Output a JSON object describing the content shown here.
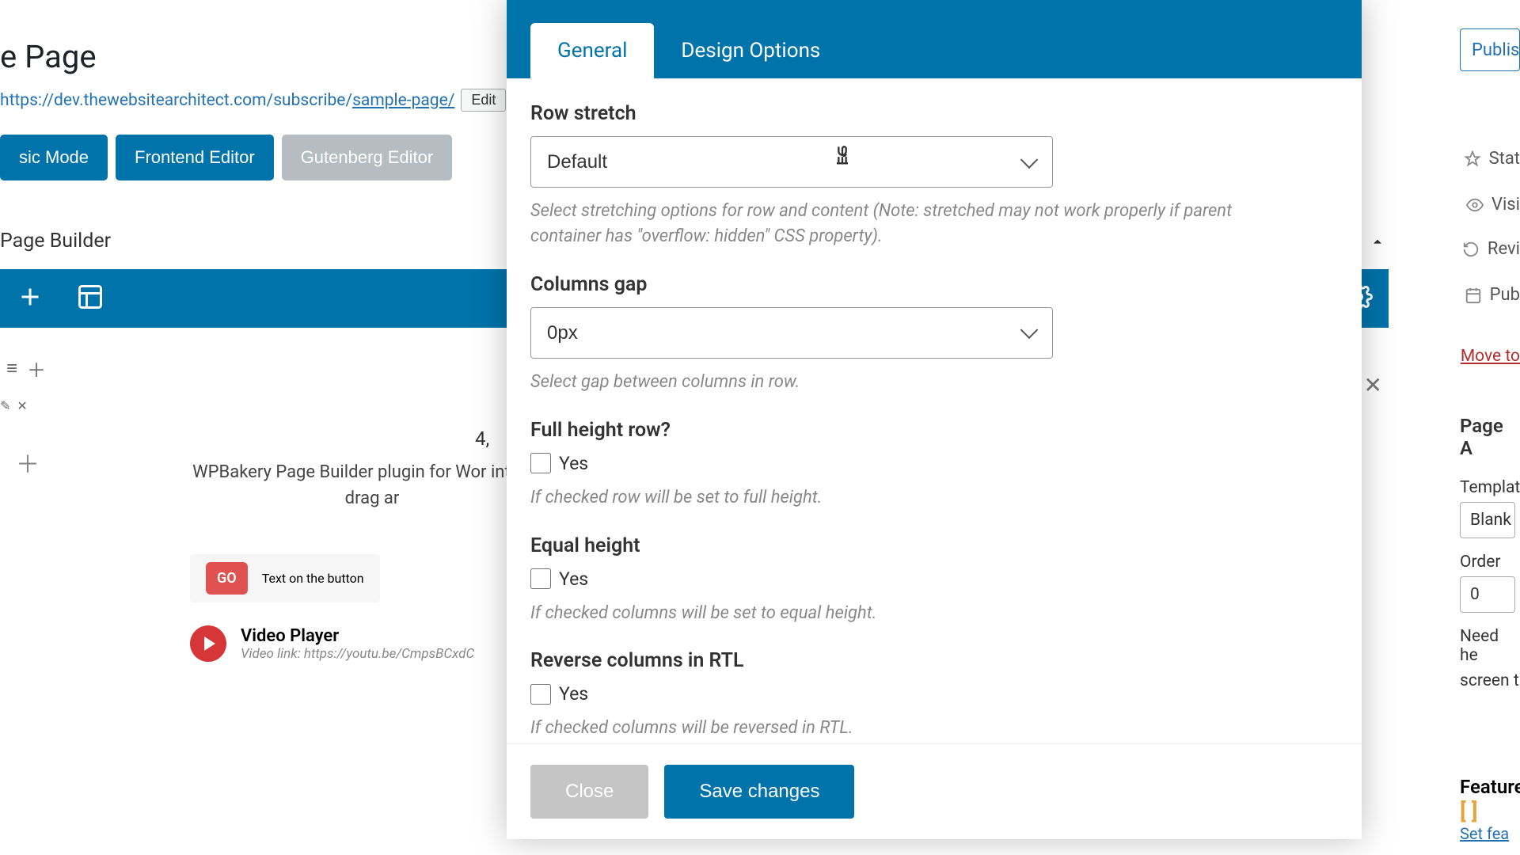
{
  "page": {
    "title_suffix": "e Page",
    "permalink": "https://dev.thewebsitearchitect.com/subscribe/",
    "permalink_slug": "sample-page/",
    "edit_label": "Edit"
  },
  "editor_modes": {
    "classic_partial": "sic Mode",
    "frontend": "Frontend Editor",
    "gutenberg": "Gutenberg Editor"
  },
  "builder": {
    "title_partial": " Page Builder",
    "count_hint": "4,",
    "content_text": "WPBakery Page Builder plugin for Wor intuitive drag ar",
    "go_badge": "GO",
    "button_text": "Text on the button",
    "video_title": "Video Player",
    "video_link_label": "Video link: https://youtu.be/CmpsBCxdC"
  },
  "publish": {
    "button_partial": "Publish",
    "stat_partial": "Stat",
    "visi_partial": "Visi",
    "revi_partial": "Revi",
    "pub_partial": "Pub",
    "move_to_partial": "Move to"
  },
  "attributes": {
    "title_partial": "Page A",
    "template_partial": "Templat",
    "template_value": "Blank",
    "order_label": "Order",
    "order_value": "0",
    "need_partial": "Need he",
    "screen_partial": "screen t"
  },
  "features": {
    "title_partial": "Feature",
    "set_partial": "Set fea"
  },
  "modal": {
    "tabs": {
      "general": "General",
      "design": "Design Options"
    },
    "fields": {
      "row_stretch": {
        "label": "Row stretch",
        "value": "Default",
        "help": "Select stretching options for row and content (Note: stretched may not work properly if parent container has \"overflow: hidden\" CSS property)."
      },
      "columns_gap": {
        "label": "Columns gap",
        "value": "0px",
        "help": "Select gap between columns in row."
      },
      "full_height": {
        "label": "Full height row?",
        "yes": "Yes",
        "help": "If checked row will be set to full height."
      },
      "equal_height": {
        "label": "Equal height",
        "yes": "Yes",
        "help": "If checked columns will be set to equal height."
      },
      "reverse_rtl": {
        "label": "Reverse columns in RTL",
        "yes": "Yes",
        "help": "If checked columns will be reversed in RTL."
      }
    },
    "actions": {
      "close": "Close",
      "save": "Save changes"
    }
  }
}
